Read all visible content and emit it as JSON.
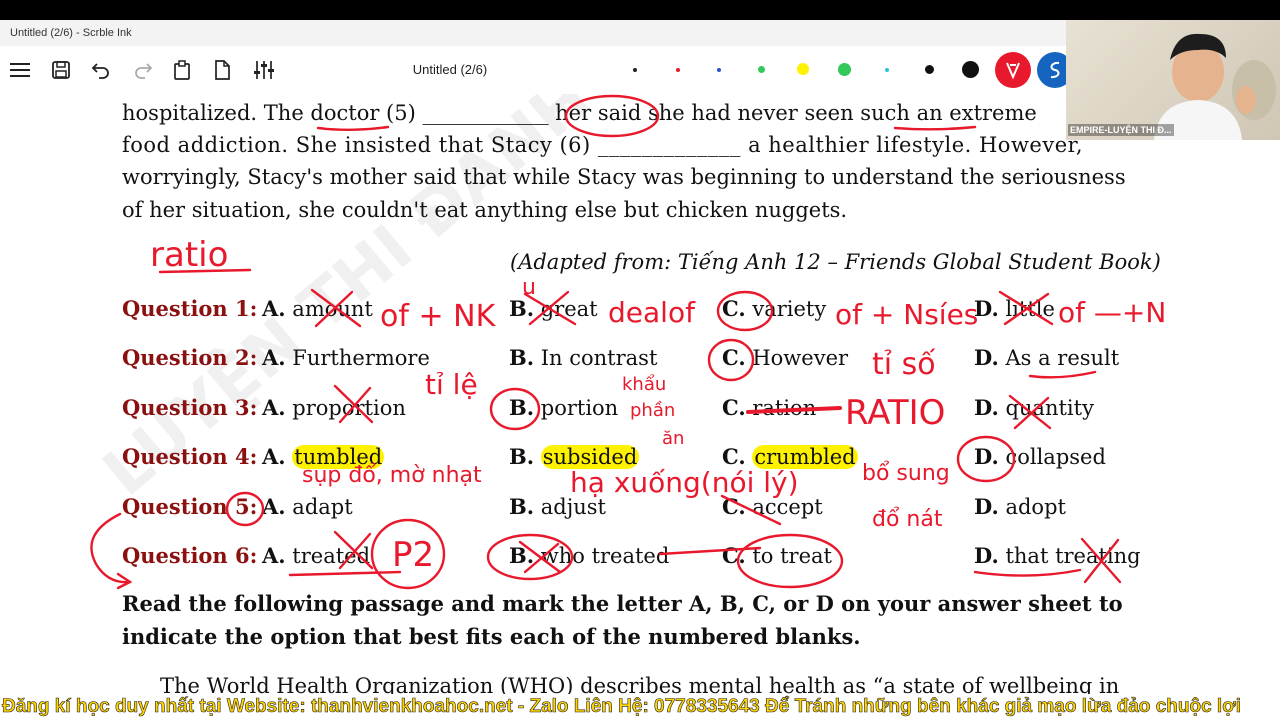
{
  "window": {
    "title": "Untitled (2/6) - Scrble Ink"
  },
  "toolbar": {
    "doc_title": "Untitled (2/6)",
    "icons": [
      "menu-icon",
      "save-icon",
      "undo-icon",
      "redo-icon",
      "clipboard-icon",
      "page-icon",
      "settings-sliders-icon"
    ],
    "pen_colors": [
      "#222222",
      "#e8192c",
      "#2a52d0",
      "#34c759",
      "#fff200",
      "#34c759",
      "#26c6da",
      "#111111",
      "#111111",
      "#e8192c",
      "#1565c0"
    ]
  },
  "passage": {
    "line1": "hospitalized. The doctor (5) ____________ her said she had never seen such an extreme",
    "line2": "food addiction. She insisted that Stacy (6) _____________ a healthier lifestyle. However,",
    "line3": "worryingly, Stacy's mother said that while Stacy was beginning to understand the seriousness",
    "line4": "of her situation, she couldn't eat anything else but chicken nuggets.",
    "source": "(Adapted from: Tiếng Anh 12 – Friends Global Student Book)"
  },
  "questions": [
    {
      "label": "Question 1:",
      "a": "amount",
      "b": "great",
      "c": "variety",
      "d": "little"
    },
    {
      "label": "Question 2:",
      "a": "Furthermore",
      "b": "In contrast",
      "c": "However",
      "d": "As a result"
    },
    {
      "label": "Question 3:",
      "a": "proportion",
      "b": "portion",
      "c": "ration",
      "d": "quantity"
    },
    {
      "label": "Question 4:",
      "a": "tumbled",
      "b": "subsided",
      "c": "crumbled",
      "d": "collapsed"
    },
    {
      "label": "Question 5:",
      "a": "adapt",
      "b": "adjust",
      "c": "accept",
      "d": "adopt"
    },
    {
      "label": "Question 6:",
      "a": "treated",
      "b": "who treated",
      "c": "to treat",
      "d": "that treating"
    }
  ],
  "letters": {
    "a": "A.",
    "b": "B.",
    "c": "C.",
    "d": "D."
  },
  "instruction": {
    "line1": "Read the following passage and mark the letter A, B, C, or D on your answer sheet to",
    "line2": "indicate the option that best fits each of the numbered blanks."
  },
  "next_passage": "The World Health Organization (WHO) describes mental health as “a state of wellbeing in",
  "watermark": "LUYỆN THI ĐÁNH GIÁ",
  "annotations": {
    "ratio": "ratio",
    "q1_a": "of + NK",
    "q1_b": "u",
    "q1_deal": "dealof",
    "q1_c": "of + Nsíes",
    "q1_d": "of —+N",
    "q2_c": "tỉ số",
    "q3_a": "tỉ lệ",
    "q3_b1": "khẩu",
    "q3_b2": "phần",
    "q3_b3": "ăn",
    "q3_c": "RATIO",
    "q4_a": "sụp đổ, mờ nhạt",
    "q4_b": "hạ xuống(nói lý)",
    "q4_c1": "bổ sung",
    "q4_c2": "đổ nát",
    "q6_a": "P2"
  },
  "webcam": {
    "label": "EMPIRE-LUYỆN THI Đ..."
  },
  "banner": {
    "text": "Đăng kí học duy nhất tại Website: thanhvienkhoahoc.net - Zalo Liên Hệ: 0778335643 Để Tránh những bên khác giả mạo lừa đảo chuộc lợi"
  }
}
